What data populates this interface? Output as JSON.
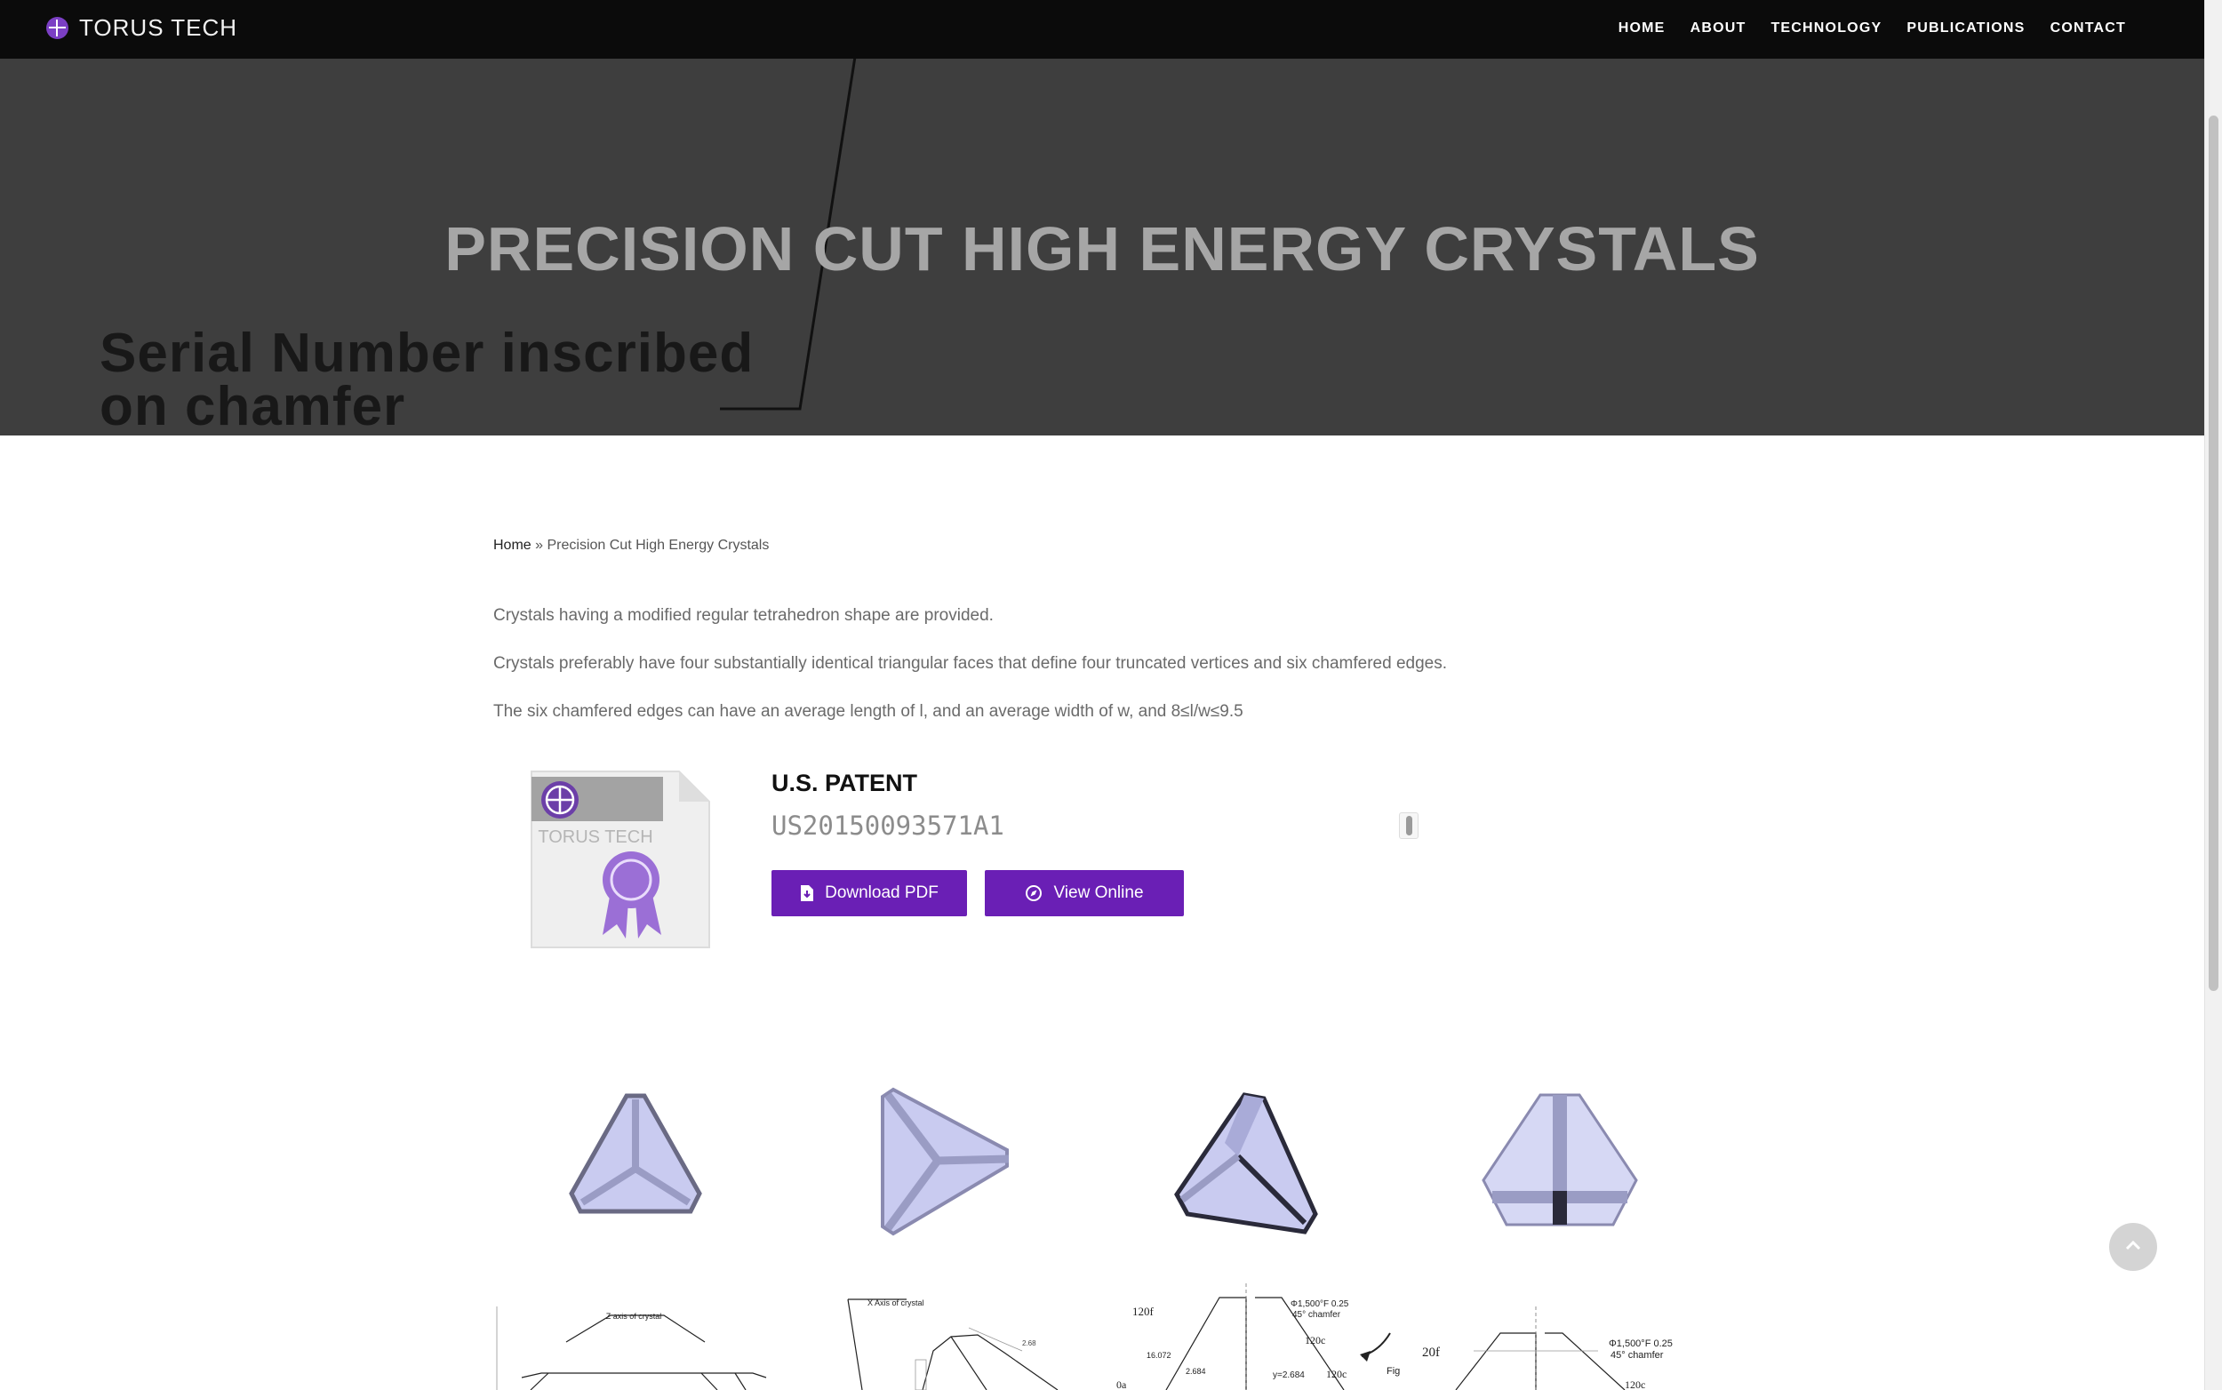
{
  "navbar": {
    "brand": "TORUS TECH",
    "menu": [
      "HOME",
      "ABOUT",
      "TECHNOLOGY",
      "PUBLICATIONS",
      "CONTACT"
    ]
  },
  "hero": {
    "title": "PRECISION CUT HIGH ENERGY CRYSTALS",
    "background_text_line1": "Serial Number inscribed",
    "background_text_line2": "on chamfer"
  },
  "breadcrumb": {
    "home": "Home",
    "separator": " » ",
    "current": "Precision Cut High Energy Crystals"
  },
  "content": {
    "paragraphs": [
      "Crystals having a modified regular tetrahedron shape are provided.",
      "Crystals preferably have four substantially identical triangular faces that define four truncated vertices and six chamfered edges.",
      "The six chamfered edges can have an average length of l, and an average width of w, and 8≤l/w≤9.5"
    ]
  },
  "patent": {
    "label": "U.S. PATENT",
    "number": "US20150093571A1",
    "icon_brand": "TORUS TECH",
    "download_label": "Download PDF",
    "view_label": "View Online"
  },
  "drawings": {
    "d1_caption": "Z axis of crystal",
    "d2_caption": "X Axis of crystal",
    "d2_dim": "2.68",
    "d3_angle": "120f",
    "d3_chamfer1": "Φ1,500°F 0.25",
    "d3_chamfer2": "45° chamfer",
    "d3_dim_a": "16.072",
    "d3_dim_b": "2.684",
    "d3_dim_c": "y=2.684",
    "d3_label_c": "120c",
    "d3_label_a": "0a",
    "d3_fig": "Fig",
    "d4_angle": "20f",
    "d4_chamfer1": "Φ1,500°F 0.25",
    "d4_chamfer2": "45° chamfer",
    "d4_label_c": "120c"
  },
  "colors": {
    "accent_purple": "#6a1fb5",
    "hero_bg": "#3e3e3e",
    "navbar_bg": "#0b0b0b",
    "crystal_face": "#c9cbf0"
  },
  "icons": {
    "download": "file-download-icon",
    "view": "compass-icon",
    "back_to_top": "chevron-up-icon"
  }
}
